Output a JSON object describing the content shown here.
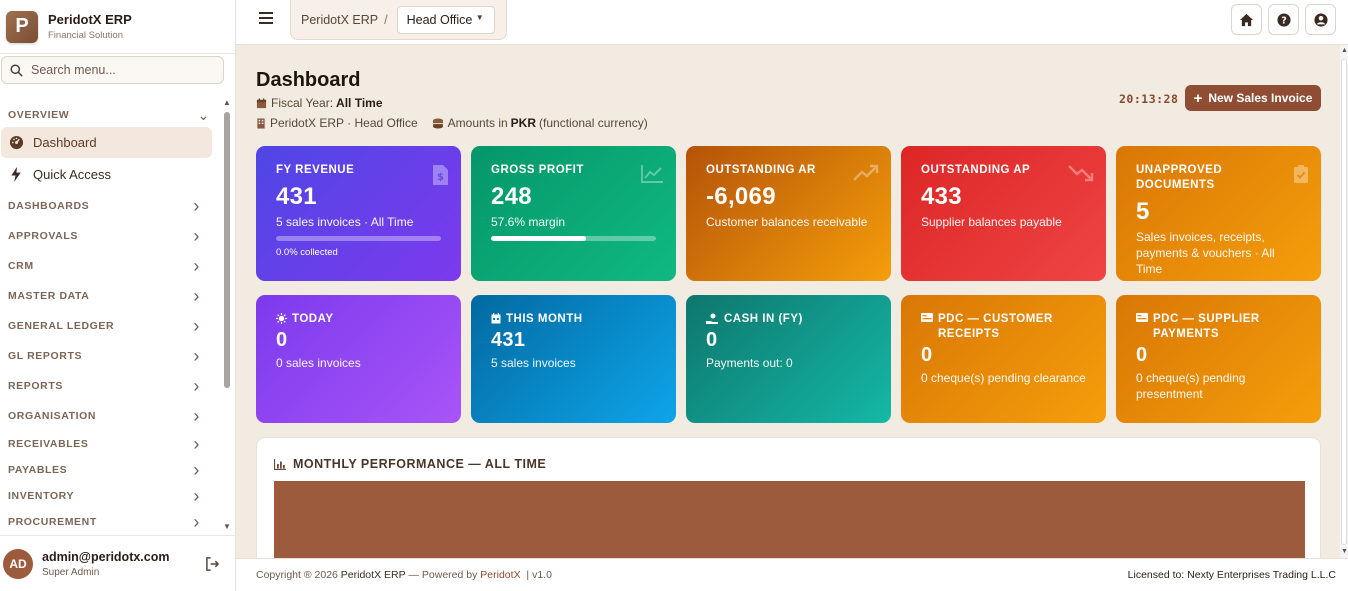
{
  "brand": {
    "logo_letter": "P",
    "name": "PeridotX ERP",
    "subtitle": "Financial Solution"
  },
  "search": {
    "placeholder": "Search menu..."
  },
  "nav": {
    "overview_label": "OVERVIEW",
    "dashboard_label": "Dashboard",
    "quick_access_label": "Quick Access",
    "groups": [
      "DASHBOARDS",
      "APPROVALS",
      "CRM",
      "MASTER DATA",
      "GENERAL LEDGER",
      "GL REPORTS",
      "REPORTS",
      "ORGANISATION",
      "RECEIVABLES",
      "PAYABLES",
      "INVENTORY",
      "PROCUREMENT"
    ]
  },
  "user": {
    "initials": "AD",
    "email": "admin@peridotx.com",
    "role": "Super Admin"
  },
  "topbar": {
    "breadcrumb_root": "PeridotX ERP",
    "breadcrumb_sep": "/",
    "office": "Head Office"
  },
  "page": {
    "title": "Dashboard",
    "fiscal_label": "Fiscal Year:",
    "fiscal_value": "All Time",
    "org_text": "PeridotX ERP · Head Office",
    "amounts_prefix": "Amounts in",
    "amounts_currency": "PKR",
    "amounts_suffix": "(functional currency)",
    "clock": "20:13:28",
    "new_button": "New Sales Invoice"
  },
  "cards_row1": {
    "fy_revenue": {
      "label": "FY REVENUE",
      "value": "431",
      "sub": "5 sales invoices · All Time",
      "collected_text": "0.0% collected",
      "collected_fraction": 0.0
    },
    "gross_profit": {
      "label": "GROSS PROFIT",
      "value": "248",
      "sub": "57.6% margin",
      "margin_fraction": 0.576
    },
    "outstanding_ar": {
      "label": "OUTSTANDING AR",
      "value": "-6,069",
      "sub": "Customer balances receivable"
    },
    "outstanding_ap": {
      "label": "OUTSTANDING AP",
      "value": "433",
      "sub": "Supplier balances payable"
    },
    "unapproved": {
      "label": "UNAPPROVED DOCUMENTS",
      "value": "5",
      "sub": "Sales invoices, receipts, payments & vouchers · All Time"
    }
  },
  "cards_row2": {
    "today": {
      "label": "TODAY",
      "value": "0",
      "sub": "0 sales invoices"
    },
    "this_month": {
      "label": "THIS MONTH",
      "value": "431",
      "sub": "5 sales invoices"
    },
    "cash_in": {
      "label": "CASH IN (FY)",
      "value": "0",
      "sub": "Payments out: 0"
    },
    "pdc_customer": {
      "label": "PDC — CUSTOMER RECEIPTS",
      "value": "0",
      "sub": "0 cheque(s) pending clearance"
    },
    "pdc_supplier": {
      "label": "PDC — SUPPLIER PAYMENTS",
      "value": "0",
      "sub": "0 cheque(s) pending presentment"
    }
  },
  "panel": {
    "title": "MONTHLY PERFORMANCE — ALL TIME"
  },
  "footer": {
    "copyright_prefix": "Copyright ® 2026",
    "brand": "PeridotX ERP",
    "powered_prefix": "— Powered by",
    "powered_by": "PeridotX",
    "version": "| v1.0",
    "licensed": "Licensed to: Nexty Enterprises Trading L.L.C"
  },
  "colors": {
    "accent": "#8f4e33",
    "fy_revenue": "#5b3ff0",
    "gross_profit": "#10b07a",
    "outstanding_ar": "#c9670a",
    "outstanding_ap": "#e8333a",
    "unapproved": "#f19a0f",
    "today": "#8b4ef0",
    "this_month": "#0aa0e8",
    "cash_in": "#13a99a"
  }
}
